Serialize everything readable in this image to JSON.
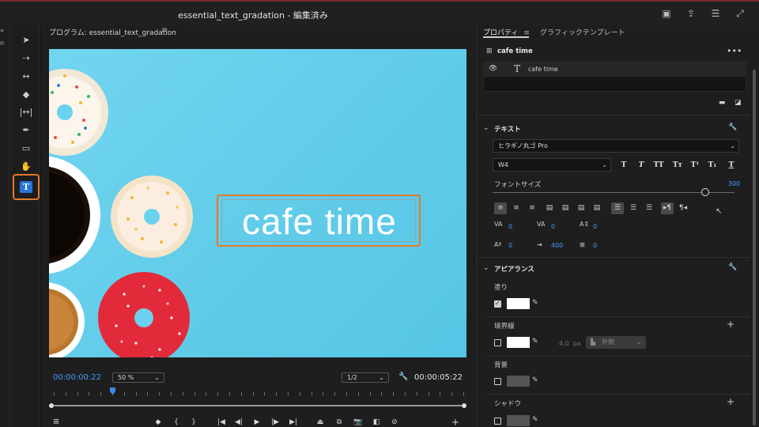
{
  "window": {
    "title": "essential_text_gradation - 編集済み"
  },
  "program_monitor": {
    "title": "プログラム: essential_text_gradation",
    "menu_icon": "≡",
    "caption": "cafe time",
    "current_time": "00:00:00:22",
    "zoom": "50 %",
    "resolution": "1/2",
    "duration": "00:00:05:22"
  },
  "tools": [
    "selection-tool",
    "track-select-tool",
    "ripple-edit-tool",
    "razor-tool",
    "slip-tool",
    "pen-tool",
    "rectangle-tool",
    "hand-tool",
    "type-tool"
  ],
  "properties": {
    "tab_active": "プロパティ",
    "tab_active_menu": "≡",
    "tab_inactive": "グラフィックテンプレート",
    "layer_header": "cafe time",
    "layer_item": "cafe time",
    "text_section": "テキスト",
    "font": "ヒラギノ丸ゴ Pro",
    "weight": "W4",
    "style_buttons": [
      "T",
      "T",
      "TT",
      "Tт",
      "T¹",
      "T₁",
      "T"
    ],
    "font_size_label": "フォントサイズ",
    "font_size": "300",
    "font_size_fraction": 0.88,
    "kerning": "0",
    "tracking": "0",
    "leading": "0",
    "baseline": "0",
    "tsume": "400",
    "tab_width": "0",
    "appearance_section": "アピアランス",
    "fill_label": "塗り",
    "fill_color": "#ffffff",
    "stroke_label": "境界線",
    "stroke_color": "#ffffff",
    "stroke_width": "4.0",
    "stroke_unit": "px",
    "stroke_position": "外側",
    "background_label": "背景",
    "shadow_label": "シャドウ"
  }
}
